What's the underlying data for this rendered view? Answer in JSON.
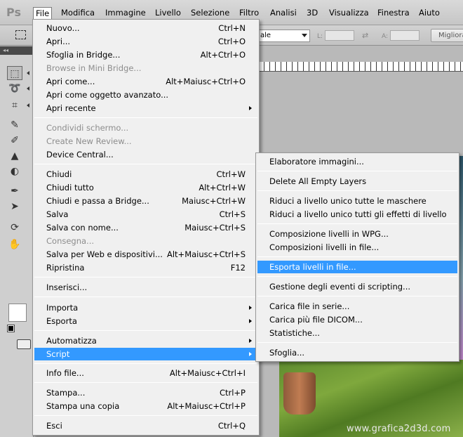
{
  "menubar": {
    "logo": "Ps",
    "items": [
      "File",
      "Modifica",
      "Immagine",
      "Livello",
      "Selezione",
      "Filtro",
      "Analisi",
      "3D",
      "Visualizza",
      "Finestra",
      "Aiuto"
    ]
  },
  "options": {
    "mode_value": "ale",
    "l_label": "L:",
    "a_label": "A:",
    "refine_label": "Migliora"
  },
  "file_menu": [
    {
      "label": "Nuovo...",
      "shortcut": "Ctrl+N"
    },
    {
      "label": "Apri...",
      "shortcut": "Ctrl+O"
    },
    {
      "label": "Sfoglia in Bridge...",
      "shortcut": "Alt+Ctrl+O"
    },
    {
      "label": "Browse in Mini Bridge...",
      "shortcut": "",
      "disabled": true
    },
    {
      "label": "Apri come...",
      "shortcut": "Alt+Maiusc+Ctrl+O"
    },
    {
      "label": "Apri come oggetto avanzato...",
      "shortcut": ""
    },
    {
      "label": "Apri recente",
      "shortcut": "",
      "submenu": true
    },
    {
      "label": "Condividi schermo...",
      "shortcut": "",
      "disabled": true
    },
    {
      "label": "Create New Review...",
      "shortcut": "",
      "disabled": true
    },
    {
      "label": "Device Central...",
      "shortcut": ""
    },
    {
      "label": "Chiudi",
      "shortcut": "Ctrl+W"
    },
    {
      "label": "Chiudi tutto",
      "shortcut": "Alt+Ctrl+W"
    },
    {
      "label": "Chiudi e passa a Bridge...",
      "shortcut": "Maiusc+Ctrl+W"
    },
    {
      "label": "Salva",
      "shortcut": "Ctrl+S"
    },
    {
      "label": "Salva con nome...",
      "shortcut": "Maiusc+Ctrl+S"
    },
    {
      "label": "Consegna...",
      "shortcut": "",
      "disabled": true
    },
    {
      "label": "Salva per Web e dispositivi...",
      "shortcut": "Alt+Maiusc+Ctrl+S"
    },
    {
      "label": "Ripristina",
      "shortcut": "F12"
    },
    {
      "label": "Inserisci...",
      "shortcut": ""
    },
    {
      "label": "Importa",
      "shortcut": "",
      "submenu": true
    },
    {
      "label": "Esporta",
      "shortcut": "",
      "submenu": true
    },
    {
      "label": "Automatizza",
      "shortcut": "",
      "submenu": true
    },
    {
      "label": "Script",
      "shortcut": "",
      "submenu": true,
      "highlighted": true
    },
    {
      "label": "Info file...",
      "shortcut": "Alt+Maiusc+Ctrl+I"
    },
    {
      "label": "Stampa...",
      "shortcut": "Ctrl+P"
    },
    {
      "label": "Stampa una copia",
      "shortcut": "Alt+Maiusc+Ctrl+P"
    },
    {
      "label": "Esci",
      "shortcut": "Ctrl+Q"
    }
  ],
  "script_menu": [
    {
      "label": "Elaboratore immagini..."
    },
    {
      "label": "Delete All Empty Layers"
    },
    {
      "label": "Riduci a livello unico tutte le maschere"
    },
    {
      "label": "Riduci a livello unico tutti gli effetti di livello"
    },
    {
      "label": "Composizione livelli in WPG..."
    },
    {
      "label": "Composizioni livelli in file..."
    },
    {
      "label": "Esporta livelli in file...",
      "highlighted": true
    },
    {
      "label": "Gestione degli eventi di scripting..."
    },
    {
      "label": "Carica file in serie..."
    },
    {
      "label": "Carica più file DICOM..."
    },
    {
      "label": "Statistiche..."
    },
    {
      "label": "Sfoglia..."
    }
  ],
  "watermark": "www.grafica2d3d.com"
}
